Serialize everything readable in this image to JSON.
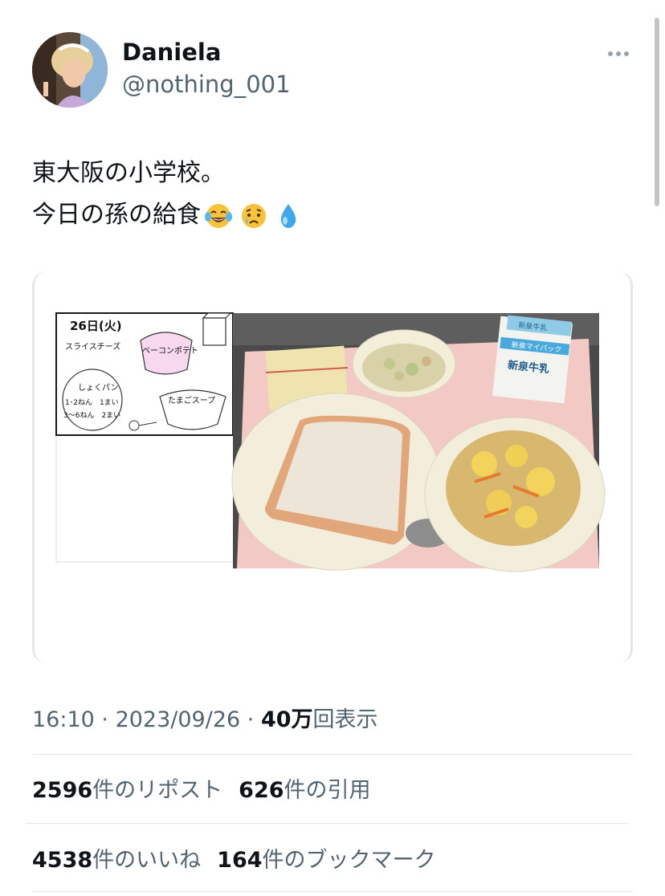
{
  "user": {
    "display_name": "Daniela",
    "handle": "@nothing_001"
  },
  "tweet": {
    "line1": "東大阪の小学校。",
    "line2": "今日の孫の給食",
    "emojis": [
      "face-with-tears-of-joy-icon",
      "crying-face-icon",
      "droplet-icon"
    ]
  },
  "media": {
    "menu_card": {
      "date": "26日(火)",
      "cheese": "スライスチーズ",
      "potato": "ベーコンポテト",
      "bread": "しょくパン",
      "bread_note1": "1･2ねん　1まい",
      "bread_note2": "3〜6ねん　2まい",
      "soup": "たまごスープ"
    },
    "milk_label": "新泉牛乳",
    "milk_top": "新泉牛乳",
    "milk_band": "新泉マイパック"
  },
  "meta": {
    "time": "16:10",
    "sep1": " · ",
    "date": "2023/09/26",
    "sep2": " · ",
    "views_count": "40万",
    "views_label": "回表示"
  },
  "stats": {
    "reposts_count": "2596",
    "reposts_label": "件のリポスト",
    "quotes_count": "626",
    "quotes_label": "件の引用",
    "likes_count": "4538",
    "likes_label": "件のいいね",
    "bookmarks_count": "164",
    "bookmarks_label": "件のブックマーク"
  },
  "colors": {
    "text_primary": "#0f1419",
    "text_secondary": "#536471",
    "tray_pink": "#f2c9c4",
    "divider": "#e3e6e8"
  }
}
